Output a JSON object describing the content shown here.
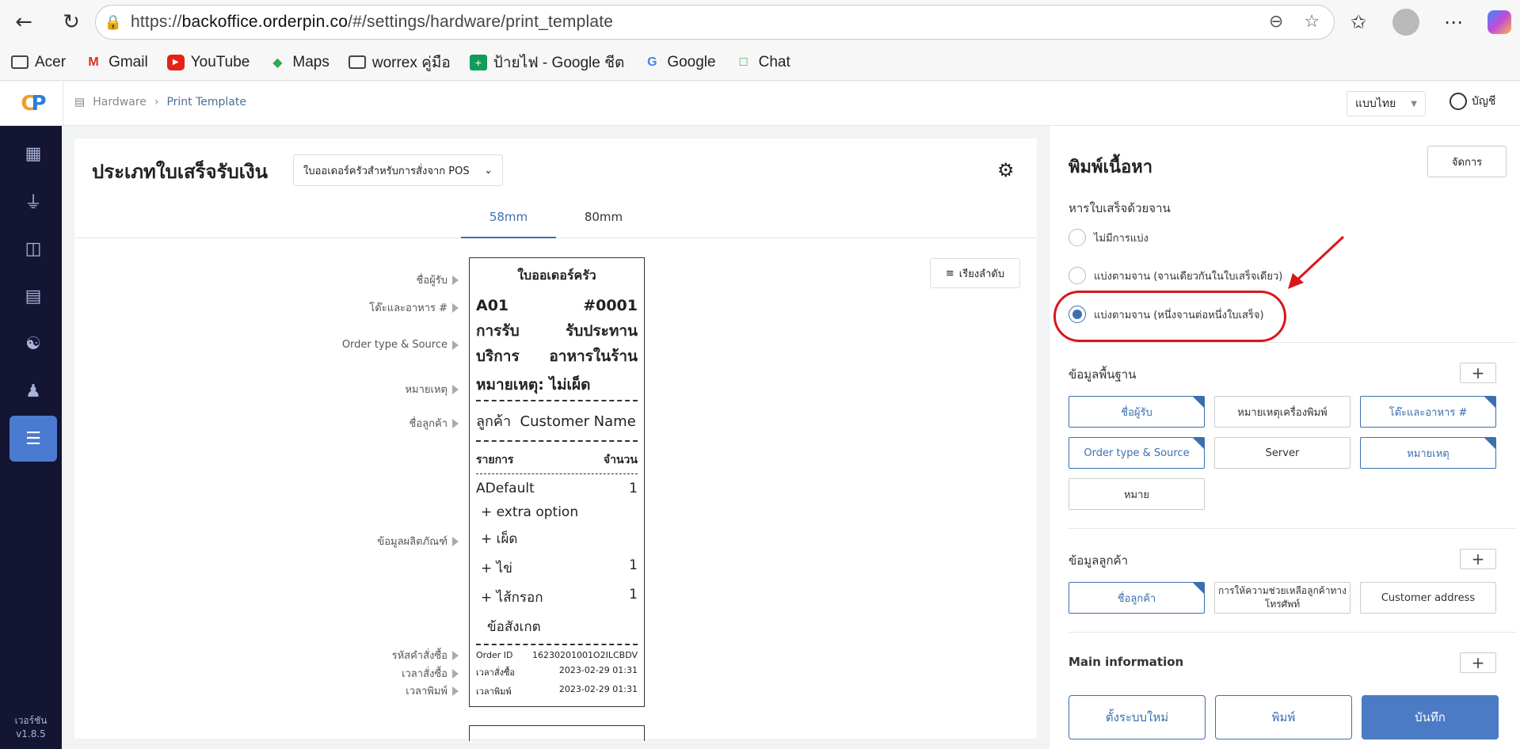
{
  "browser": {
    "url_prefix": "https://",
    "url_domain": "backoffice.orderpin.co",
    "url_path": "/#/settings/hardware/print_template",
    "bookmarks": [
      {
        "label": "Acer",
        "icon": "folder-icon"
      },
      {
        "label": "Gmail",
        "icon": "gmail-icon"
      },
      {
        "label": "YouTube",
        "icon": "youtube-icon"
      },
      {
        "label": "Maps",
        "icon": "maps-icon"
      },
      {
        "label": "worrex คู่มือ",
        "icon": "folder-icon"
      },
      {
        "label": "ป้ายไฟ - Google ชีต",
        "icon": "sheets-icon"
      },
      {
        "label": "Google",
        "icon": "google-icon"
      },
      {
        "label": "Chat",
        "icon": "chat-icon"
      }
    ]
  },
  "header": {
    "breadcrumb": [
      "Hardware",
      "Print Template"
    ],
    "language": "แบบไทย",
    "account": "บัญชี"
  },
  "sidebar": {
    "version_label": "เวอร์ชัน",
    "version": "v1.8.5"
  },
  "main": {
    "title": "ประเภทใบเสร็จรับเงิน",
    "type_select": "ใบออเดอร์ครัวสำหรับการสั่งจาก POS",
    "tabs": [
      "58mm",
      "80mm"
    ],
    "active_tab": "58mm",
    "sort_label": "เรียงลำดับ",
    "labels": [
      "ชื่อผู้รับ",
      "โต๊ะและอาหาร #",
      "Order type & Source",
      "หมายเหตุ",
      "ชื่อลูกค้า",
      "ข้อมูลผลิตภัณฑ์",
      "รหัสคำสั่งซื้อ",
      "เวลาสั่งซื้อ",
      "เวลาพิมพ์"
    ]
  },
  "receipt": {
    "title": "ใบออเดอร์ครัว",
    "table": "A01",
    "order_no": "#0001",
    "service_line1_left": "การรับ",
    "service_line1_right": "รับประทาน",
    "service_line2_left": "บริการ",
    "service_line2_right": "อาหารในร้าน",
    "note": "หมายเหตุ: ไม่เผ็ด",
    "customer_label": "ลูกค้า",
    "customer_name": "Customer Name",
    "col_item": "รายการ",
    "col_qty": "จำนวน",
    "items": [
      {
        "name": "ADefault",
        "qty": "1"
      },
      {
        "name": "+ extra option",
        "qty": ""
      },
      {
        "name": "+ เผ็ด",
        "qty": ""
      },
      {
        "name": "+ ไข่",
        "qty": "1"
      },
      {
        "name": "+ ไส้กรอก",
        "qty": "1"
      },
      {
        "name": "ข้อสังเกต",
        "qty": ""
      }
    ],
    "order_id_label": "Order ID",
    "order_id": "16230201001O2ILCBDV",
    "order_time_label": "เวลาสั่งซื้อ",
    "order_time": "2023-02-29 01:31",
    "print_time_label": "เวลาพิมพ์",
    "print_time": "2023-02-29 01:31"
  },
  "right_panel": {
    "title": "พิมพ์เนื้อหา",
    "manage": "จัดการ",
    "split_label": "หารใบเสร็จด้วยจาน",
    "split_options": [
      "ไม่มีการแบ่ง",
      "แบ่งตามจาน (จานเดียวกันในใบเสร็จเดียว)",
      "แบ่งตามจาน (หนึ่งจานต่อหนึ่งใบเสร็จ)"
    ],
    "split_selected": 2,
    "basic_label": "ข้อมูลพื้นฐาน",
    "basic_chips": [
      {
        "label": "ชื่อผู้รับ",
        "on": true
      },
      {
        "label": "หมายเหตุเครื่องพิมพ์",
        "on": false
      },
      {
        "label": "โต๊ะและอาหาร #",
        "on": true
      },
      {
        "label": "Order type & Source",
        "on": true
      },
      {
        "label": "Server",
        "on": false
      },
      {
        "label": "หมายเหตุ",
        "on": true
      },
      {
        "label": "หมาย",
        "on": false
      }
    ],
    "customer_label": "ข้อมูลลูกค้า",
    "customer_chips": [
      {
        "label": "ชื่อลูกค้า",
        "on": true
      },
      {
        "label": "การให้ความช่วยเหลือลูกค้าทางโทรศัพท์",
        "on": false
      },
      {
        "label": "Customer address",
        "on": false
      }
    ],
    "main_info_label": "Main information",
    "buttons": {
      "reset": "ตั้งระบบใหม่",
      "print": "พิมพ์",
      "save": "บันทึก"
    }
  },
  "colors": {
    "accent": "#3b6fb0",
    "sidebar": "#131532",
    "annotation": "#d9171b"
  }
}
